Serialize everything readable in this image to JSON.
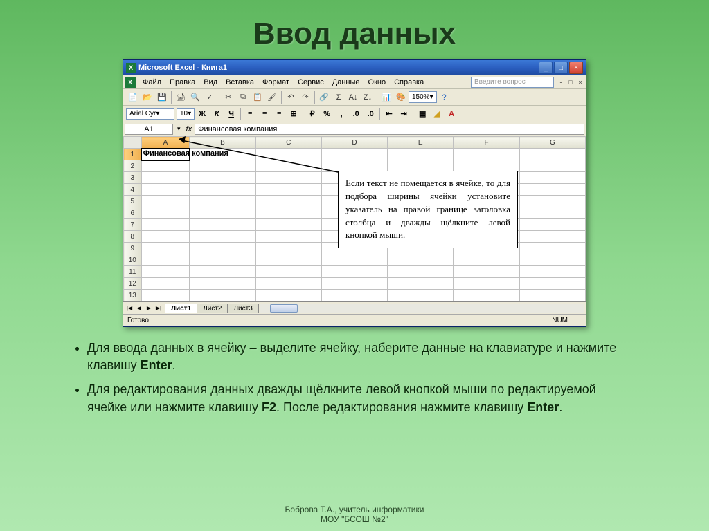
{
  "slide": {
    "title": "Ввод данных"
  },
  "window": {
    "title": "Microsoft Excel - Книга1"
  },
  "menus": [
    "Файл",
    "Правка",
    "Вид",
    "Вставка",
    "Формат",
    "Сервис",
    "Данные",
    "Окно",
    "Справка"
  ],
  "help_placeholder": "Введите вопрос",
  "toolbar": {
    "zoom": "150%"
  },
  "format": {
    "font_name": "Arial Cyr",
    "font_size": "10"
  },
  "formula_bar": {
    "cell_ref": "A1",
    "value": "Финансовая компания"
  },
  "grid": {
    "columns": [
      "A",
      "B",
      "C",
      "D",
      "E",
      "F",
      "G"
    ],
    "rows": [
      1,
      2,
      3,
      4,
      5,
      6,
      7,
      8,
      9,
      10,
      11,
      12,
      13
    ],
    "cell_a1_text": "Финансовая компания"
  },
  "sheets": {
    "tabs": [
      "Лист1",
      "Лист2",
      "Лист3"
    ],
    "active": 0
  },
  "status": {
    "ready": "Готово",
    "num": "NUM"
  },
  "callout": {
    "text": "Если текст не помещается в ячейке, то для подбора ширины ячейки установите указатель на правой границе заголовка столбца и дважды щёлкните левой кнопкой мыши."
  },
  "bullets": {
    "item1_prefix": "Для ввода данных в ячейку – выделите ячейку, наберите данные на клавиатуре и нажмите клавишу ",
    "item1_key": "Enter",
    "item1_suffix": ".",
    "item2_prefix": "Для редактирования данных дважды щёлкните левой кнопкой мыши по редактируемой ячейке или нажмите клавишу ",
    "item2_key1": "F2",
    "item2_mid": ". После редактирования нажмите клавишу ",
    "item2_key2": "Enter",
    "item2_suffix": "."
  },
  "footer": {
    "line1": "Боброва Т.А., учитель информатики",
    "line2": "МОУ \"БСОШ №2\""
  }
}
